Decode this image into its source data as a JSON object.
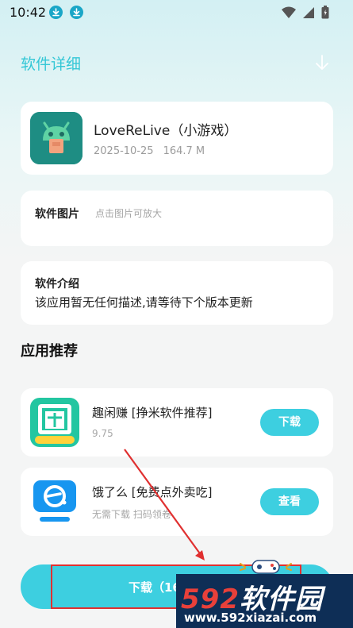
{
  "status_bar": {
    "time": "10:42"
  },
  "header": {
    "title": "软件详细"
  },
  "app": {
    "name": "LoveReLive（小游戏）",
    "date": "2025-10-25",
    "size": "164.7 M",
    "icon": "android-robot-icon",
    "icon_color": "#1e8d83"
  },
  "pictures": {
    "title": "软件图片",
    "hint": "点击图片可放大"
  },
  "intro": {
    "title": "软件介绍",
    "text": "该应用暂无任何描述,请等待下个版本更新"
  },
  "recommend": {
    "heading": "应用推荐",
    "items": [
      {
        "name": "趣闲赚 [挣米软件推荐]",
        "sub": "9.75",
        "button": "下载",
        "icon": "qu-xian-zhuan-icon"
      },
      {
        "name": "饿了么 [免费点外卖吃]",
        "sub": "无需下载 扫码领卷",
        "button": "查看",
        "icon": "eleme-icon"
      }
    ]
  },
  "download_button": {
    "label": "下载（16"
  },
  "watermark": {
    "brand_num": "592",
    "brand_text": "软件园",
    "url": "www.592xiazai.com"
  },
  "colors": {
    "accent": "#3dcfe0",
    "title_accent": "#34c7d6",
    "annotation": "#e03030"
  }
}
